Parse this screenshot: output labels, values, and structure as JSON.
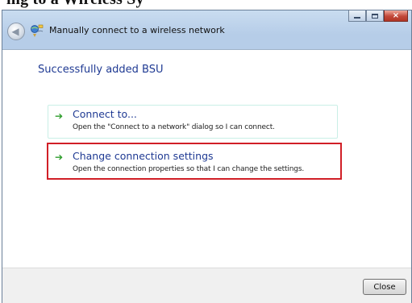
{
  "page_heading": "ing to a Wireless Sy",
  "window": {
    "title": "Manually connect to a wireless network",
    "controls": {
      "minimize": "minimize",
      "maximize": "maximize",
      "close": "×"
    }
  },
  "content": {
    "heading": "Successfully added BSU",
    "options": [
      {
        "arrow": "➔",
        "title": "Connect to...",
        "description": "Open the \"Connect to a network\" dialog so I can connect."
      },
      {
        "arrow": "➔",
        "title": "Change connection settings",
        "description": "Open the connection properties so that I can change the settings."
      }
    ]
  },
  "footer": {
    "close_label": "Close"
  },
  "colors": {
    "link_blue": "#1f3a93",
    "highlight_red": "#d11f27",
    "arrow_green": "#2e9d2c"
  }
}
